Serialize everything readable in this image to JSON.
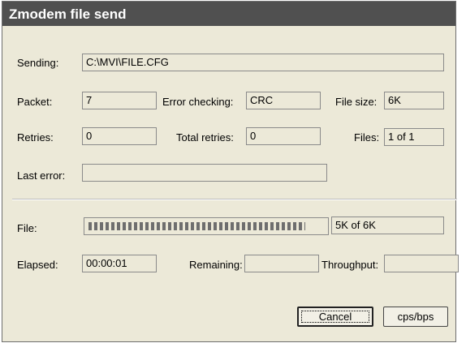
{
  "window": {
    "title": "Zmodem file send"
  },
  "sending": {
    "label": "Sending:",
    "value": "C:\\MVI\\FILE.CFG"
  },
  "packet": {
    "label": "Packet:",
    "value": "7"
  },
  "error_checking": {
    "label": "Error checking:",
    "value": "CRC"
  },
  "file_size": {
    "label": "File size:",
    "value": "6K"
  },
  "retries": {
    "label": "Retries:",
    "value": "0"
  },
  "total_retries": {
    "label": "Total retries:",
    "value": "0"
  },
  "files": {
    "label": "Files:",
    "value": "1 of 1"
  },
  "last_error": {
    "label": "Last error:",
    "value": ""
  },
  "file": {
    "label": "File:",
    "progress": 0.92,
    "status": "5K of 6K"
  },
  "elapsed": {
    "label": "Elapsed:",
    "value": "00:00:01"
  },
  "remaining": {
    "label": "Remaining:",
    "value": ""
  },
  "throughput": {
    "label": "Throughput:",
    "value": ""
  },
  "buttons": {
    "cancel": "Cancel",
    "cps_bps": "cps/bps"
  }
}
